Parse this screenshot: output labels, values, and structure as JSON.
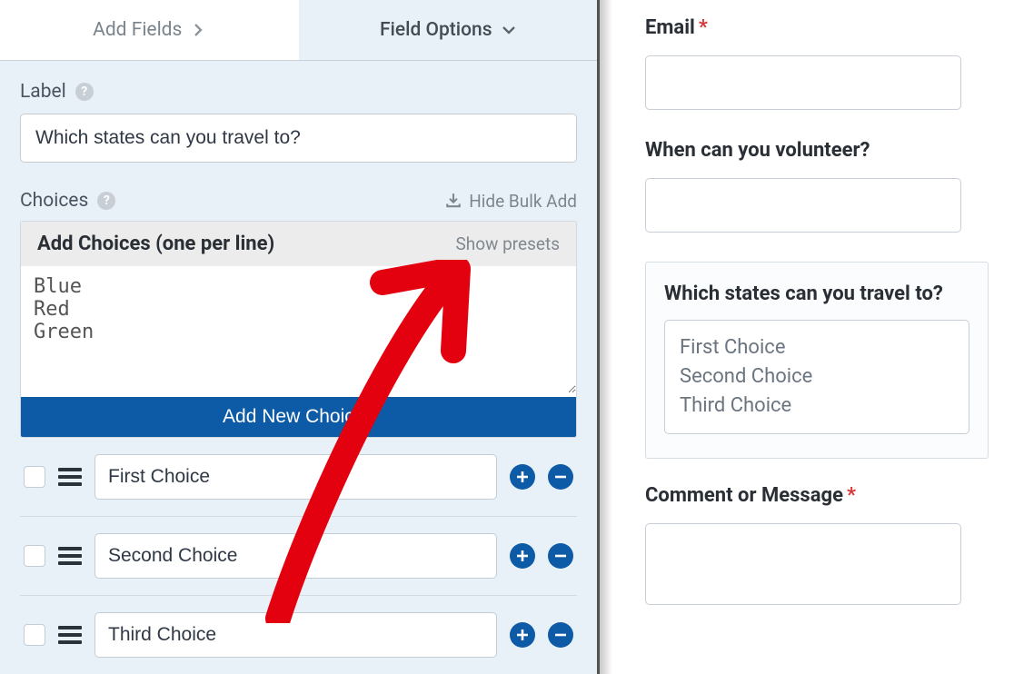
{
  "tabs": {
    "add_fields": "Add Fields",
    "field_options": "Field Options"
  },
  "label_section": {
    "title": "Label",
    "value": "Which states can you travel to?"
  },
  "choices_section": {
    "title": "Choices",
    "hide_bulk": "Hide Bulk Add",
    "bulk_header": "Add Choices (one per line)",
    "show_presets": "Show presets",
    "bulk_text": "Blue\nRed\nGreen",
    "add_button": "Add New Choices",
    "items": [
      {
        "label": "First Choice"
      },
      {
        "label": "Second Choice"
      },
      {
        "label": "Third Choice"
      }
    ]
  },
  "preview": {
    "email_label": "Email",
    "volunteer_label": "When can you volunteer?",
    "states_label": "Which states can you travel to?",
    "states_options": [
      "First Choice",
      "Second Choice",
      "Third Choice"
    ],
    "comment_label": "Comment or Message"
  },
  "colors": {
    "accent": "#0d5aa6",
    "required": "#d63638"
  }
}
